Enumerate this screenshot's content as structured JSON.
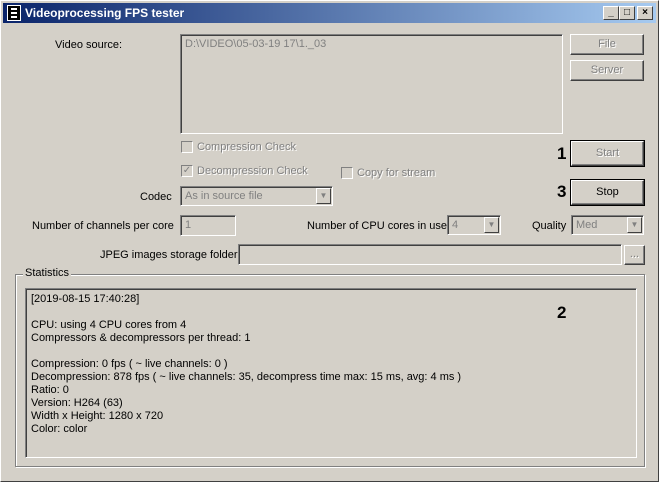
{
  "window": {
    "title": "Videoprocessing FPS tester"
  },
  "source": {
    "label": "Video source:",
    "value": "D:\\VIDEO\\05-03-19 17\\1._03",
    "file_button": "File",
    "server_button": "Server"
  },
  "options": {
    "compression_check": "Compression Check",
    "compression_checked": false,
    "decompression_check": "Decompression Check",
    "decompression_checked": true,
    "copy_for_stream": "Copy for stream",
    "copy_checked": false
  },
  "controls": {
    "start_button": "Start",
    "stop_button": "Stop",
    "codec_label": "Codec",
    "codec_value": "As in source file",
    "channels_label": "Number of channels per core",
    "channels_value": "1",
    "cores_label": "Number of CPU cores in use",
    "cores_value": "4",
    "quality_label": "Quality",
    "quality_value": "Med",
    "jpeg_label": "JPEG images storage folder",
    "jpeg_value": "",
    "browse_button": "..."
  },
  "markers": {
    "m1": "1",
    "m2": "2",
    "m3": "3"
  },
  "statistics": {
    "title": "Statistics",
    "lines": [
      "[2019-08-15 17:40:28]",
      "",
      "CPU: using 4 CPU cores from 4",
      "Compressors & decompressors per thread: 1",
      "",
      "Compression: 0 fps ( ~ live channels: 0 )",
      "Decompression: 878 fps ( ~ live channels: 35, decompress time max: 15 ms, avg: 4 ms )",
      "Ratio: 0",
      "Version: H264 (63)",
      "Width x Height: 1280 x 720",
      "Color: color"
    ]
  }
}
